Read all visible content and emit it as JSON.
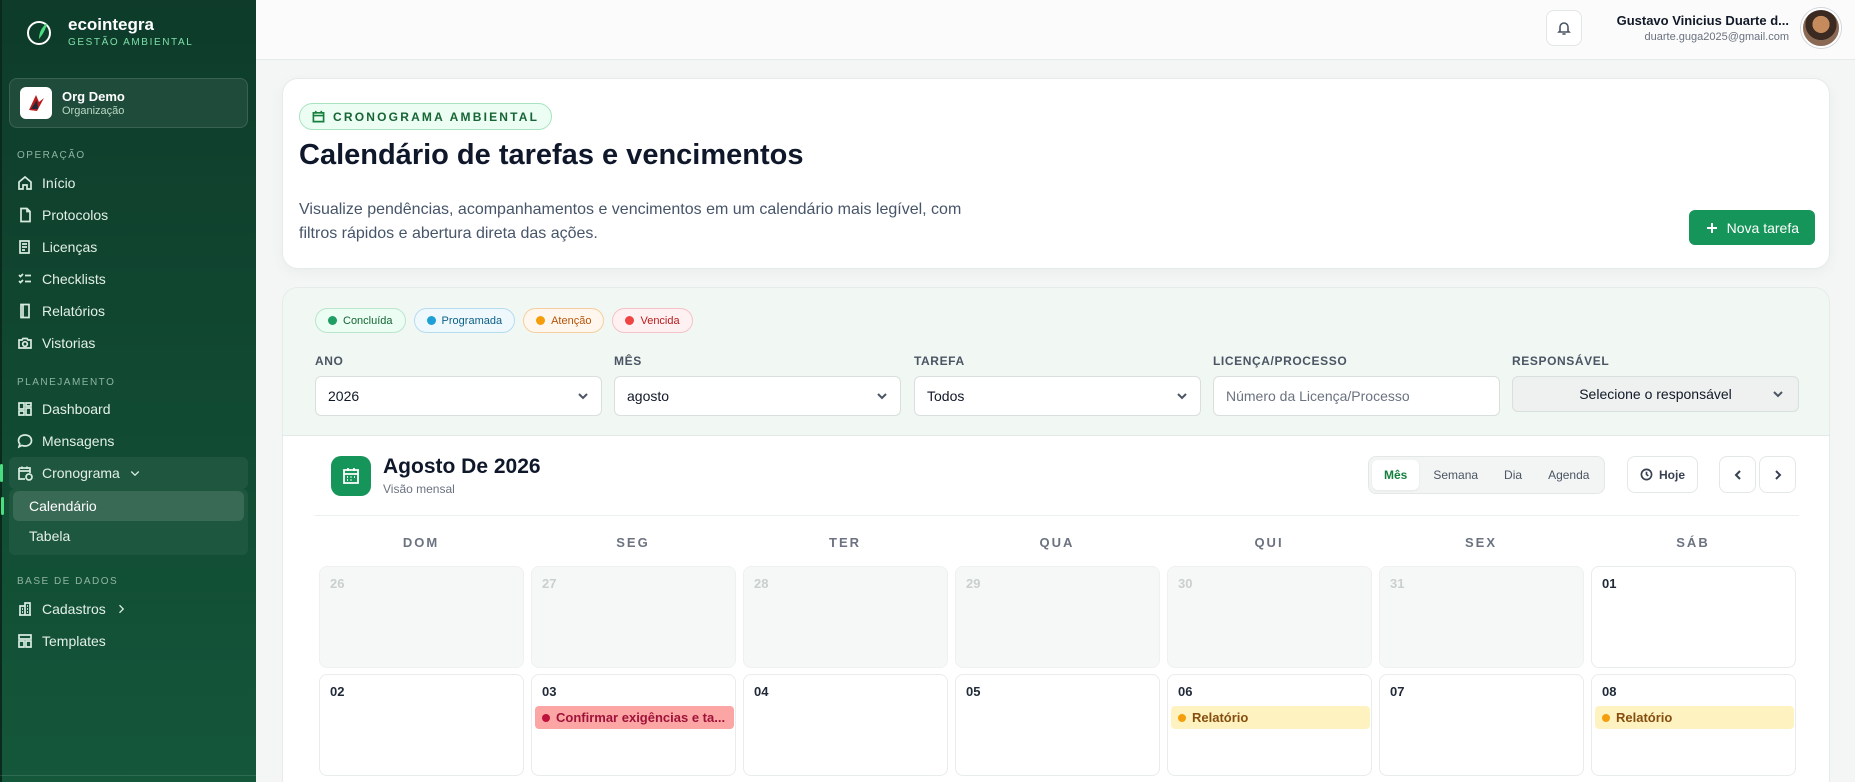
{
  "brand": {
    "name": "ecointegra",
    "subtitle": "GESTÃO AMBIENTAL"
  },
  "org": {
    "name": "Org Demo",
    "type": "Organização"
  },
  "sidebar": {
    "sections": [
      {
        "title": "OPERAÇÃO",
        "items": [
          {
            "label": "Início",
            "icon": "home-icon"
          },
          {
            "label": "Protocolos",
            "icon": "document-icon"
          },
          {
            "label": "Licenças",
            "icon": "license-icon"
          },
          {
            "label": "Checklists",
            "icon": "checklist-icon"
          },
          {
            "label": "Relatórios",
            "icon": "report-icon"
          },
          {
            "label": "Vistorias",
            "icon": "camera-icon"
          }
        ]
      },
      {
        "title": "PLANEJAMENTO",
        "items": [
          {
            "label": "Dashboard",
            "icon": "dashboard-icon"
          },
          {
            "label": "Mensagens",
            "icon": "message-icon"
          },
          {
            "label": "Cronograma",
            "icon": "calendar-clock-icon",
            "expanded": true,
            "children": [
              {
                "label": "Calendário",
                "active": true
              },
              {
                "label": "Tabela"
              }
            ]
          }
        ]
      },
      {
        "title": "BASE DE DADOS",
        "items": [
          {
            "label": "Cadastros",
            "icon": "building-icon"
          },
          {
            "label": "Templates",
            "icon": "template-icon"
          }
        ]
      }
    ]
  },
  "user": {
    "name": "Gustavo Vinicius Duarte d...",
    "email": "duarte.guga2025@gmail.com"
  },
  "hero": {
    "tag": "CRONOGRAMA AMBIENTAL",
    "title": "Calendário de tarefas e vencimentos",
    "description": "Visualize pendências, acompanhamentos e vencimentos em um calendário mais legível, com filtros rápidos e abertura direta das ações.",
    "new_task_label": "Nova tarefa"
  },
  "legend": [
    {
      "label": "Concluída",
      "color": "#1f9d63"
    },
    {
      "label": "Programada",
      "color": "#1ea0d6"
    },
    {
      "label": "Atenção",
      "color": "#f59e0b"
    },
    {
      "label": "Vencida",
      "color": "#ef4444"
    }
  ],
  "filters": {
    "year": {
      "label": "ANO",
      "value": "2026"
    },
    "month": {
      "label": "MÊS",
      "value": "agosto"
    },
    "task": {
      "label": "TAREFA",
      "value": "Todos"
    },
    "license": {
      "label": "LICENÇA/PROCESSO",
      "placeholder": "Número da Licença/Processo"
    },
    "responsible": {
      "label": "RESPONSÁVEL",
      "value": "Selecione o responsável"
    }
  },
  "calendar": {
    "title": "Agosto De 2026",
    "subtitle": "Visão mensal",
    "views": [
      "Mês",
      "Semana",
      "Dia",
      "Agenda"
    ],
    "active_view": "Mês",
    "today_label": "Hoje",
    "weekdays": [
      "DOM",
      "SEG",
      "TER",
      "QUA",
      "QUI",
      "SEX",
      "SÁB"
    ],
    "weeks": [
      [
        {
          "n": "26",
          "out": true
        },
        {
          "n": "27",
          "out": true
        },
        {
          "n": "28",
          "out": true
        },
        {
          "n": "29",
          "out": true
        },
        {
          "n": "30",
          "out": true
        },
        {
          "n": "31",
          "out": true
        },
        {
          "n": "01"
        }
      ],
      [
        {
          "n": "02"
        },
        {
          "n": "03",
          "event": {
            "label": "Confirmar exigências e ta...",
            "status": "red"
          }
        },
        {
          "n": "04"
        },
        {
          "n": "05"
        },
        {
          "n": "06",
          "event": {
            "label": "Relatório",
            "status": "yellow"
          }
        },
        {
          "n": "07"
        },
        {
          "n": "08",
          "event": {
            "label": "Relatório",
            "status": "yellow"
          }
        }
      ]
    ]
  }
}
